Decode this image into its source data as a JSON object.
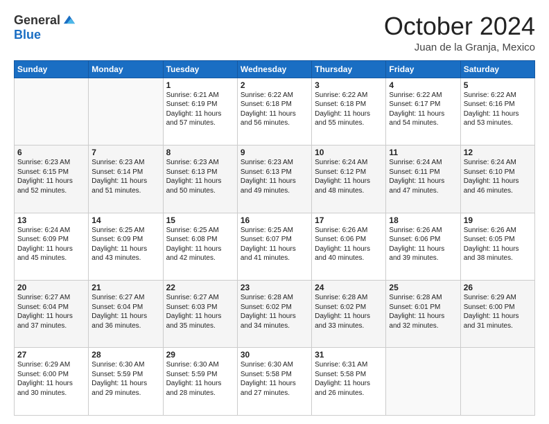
{
  "logo": {
    "general": "General",
    "blue": "Blue"
  },
  "title": "October 2024",
  "subtitle": "Juan de la Granja, Mexico",
  "weekdays": [
    "Sunday",
    "Monday",
    "Tuesday",
    "Wednesday",
    "Thursday",
    "Friday",
    "Saturday"
  ],
  "weeks": [
    [
      {
        "day": "",
        "sunrise": "",
        "sunset": "",
        "daylight": "",
        "empty": true
      },
      {
        "day": "",
        "sunrise": "",
        "sunset": "",
        "daylight": "",
        "empty": true
      },
      {
        "day": "1",
        "sunrise": "Sunrise: 6:21 AM",
        "sunset": "Sunset: 6:19 PM",
        "daylight": "Daylight: 11 hours and 57 minutes."
      },
      {
        "day": "2",
        "sunrise": "Sunrise: 6:22 AM",
        "sunset": "Sunset: 6:18 PM",
        "daylight": "Daylight: 11 hours and 56 minutes."
      },
      {
        "day": "3",
        "sunrise": "Sunrise: 6:22 AM",
        "sunset": "Sunset: 6:18 PM",
        "daylight": "Daylight: 11 hours and 55 minutes."
      },
      {
        "day": "4",
        "sunrise": "Sunrise: 6:22 AM",
        "sunset": "Sunset: 6:17 PM",
        "daylight": "Daylight: 11 hours and 54 minutes."
      },
      {
        "day": "5",
        "sunrise": "Sunrise: 6:22 AM",
        "sunset": "Sunset: 6:16 PM",
        "daylight": "Daylight: 11 hours and 53 minutes."
      }
    ],
    [
      {
        "day": "6",
        "sunrise": "Sunrise: 6:23 AM",
        "sunset": "Sunset: 6:15 PM",
        "daylight": "Daylight: 11 hours and 52 minutes."
      },
      {
        "day": "7",
        "sunrise": "Sunrise: 6:23 AM",
        "sunset": "Sunset: 6:14 PM",
        "daylight": "Daylight: 11 hours and 51 minutes."
      },
      {
        "day": "8",
        "sunrise": "Sunrise: 6:23 AM",
        "sunset": "Sunset: 6:13 PM",
        "daylight": "Daylight: 11 hours and 50 minutes."
      },
      {
        "day": "9",
        "sunrise": "Sunrise: 6:23 AM",
        "sunset": "Sunset: 6:13 PM",
        "daylight": "Daylight: 11 hours and 49 minutes."
      },
      {
        "day": "10",
        "sunrise": "Sunrise: 6:24 AM",
        "sunset": "Sunset: 6:12 PM",
        "daylight": "Daylight: 11 hours and 48 minutes."
      },
      {
        "day": "11",
        "sunrise": "Sunrise: 6:24 AM",
        "sunset": "Sunset: 6:11 PM",
        "daylight": "Daylight: 11 hours and 47 minutes."
      },
      {
        "day": "12",
        "sunrise": "Sunrise: 6:24 AM",
        "sunset": "Sunset: 6:10 PM",
        "daylight": "Daylight: 11 hours and 46 minutes."
      }
    ],
    [
      {
        "day": "13",
        "sunrise": "Sunrise: 6:24 AM",
        "sunset": "Sunset: 6:09 PM",
        "daylight": "Daylight: 11 hours and 45 minutes."
      },
      {
        "day": "14",
        "sunrise": "Sunrise: 6:25 AM",
        "sunset": "Sunset: 6:09 PM",
        "daylight": "Daylight: 11 hours and 43 minutes."
      },
      {
        "day": "15",
        "sunrise": "Sunrise: 6:25 AM",
        "sunset": "Sunset: 6:08 PM",
        "daylight": "Daylight: 11 hours and 42 minutes."
      },
      {
        "day": "16",
        "sunrise": "Sunrise: 6:25 AM",
        "sunset": "Sunset: 6:07 PM",
        "daylight": "Daylight: 11 hours and 41 minutes."
      },
      {
        "day": "17",
        "sunrise": "Sunrise: 6:26 AM",
        "sunset": "Sunset: 6:06 PM",
        "daylight": "Daylight: 11 hours and 40 minutes."
      },
      {
        "day": "18",
        "sunrise": "Sunrise: 6:26 AM",
        "sunset": "Sunset: 6:06 PM",
        "daylight": "Daylight: 11 hours and 39 minutes."
      },
      {
        "day": "19",
        "sunrise": "Sunrise: 6:26 AM",
        "sunset": "Sunset: 6:05 PM",
        "daylight": "Daylight: 11 hours and 38 minutes."
      }
    ],
    [
      {
        "day": "20",
        "sunrise": "Sunrise: 6:27 AM",
        "sunset": "Sunset: 6:04 PM",
        "daylight": "Daylight: 11 hours and 37 minutes."
      },
      {
        "day": "21",
        "sunrise": "Sunrise: 6:27 AM",
        "sunset": "Sunset: 6:04 PM",
        "daylight": "Daylight: 11 hours and 36 minutes."
      },
      {
        "day": "22",
        "sunrise": "Sunrise: 6:27 AM",
        "sunset": "Sunset: 6:03 PM",
        "daylight": "Daylight: 11 hours and 35 minutes."
      },
      {
        "day": "23",
        "sunrise": "Sunrise: 6:28 AM",
        "sunset": "Sunset: 6:02 PM",
        "daylight": "Daylight: 11 hours and 34 minutes."
      },
      {
        "day": "24",
        "sunrise": "Sunrise: 6:28 AM",
        "sunset": "Sunset: 6:02 PM",
        "daylight": "Daylight: 11 hours and 33 minutes."
      },
      {
        "day": "25",
        "sunrise": "Sunrise: 6:28 AM",
        "sunset": "Sunset: 6:01 PM",
        "daylight": "Daylight: 11 hours and 32 minutes."
      },
      {
        "day": "26",
        "sunrise": "Sunrise: 6:29 AM",
        "sunset": "Sunset: 6:00 PM",
        "daylight": "Daylight: 11 hours and 31 minutes."
      }
    ],
    [
      {
        "day": "27",
        "sunrise": "Sunrise: 6:29 AM",
        "sunset": "Sunset: 6:00 PM",
        "daylight": "Daylight: 11 hours and 30 minutes."
      },
      {
        "day": "28",
        "sunrise": "Sunrise: 6:30 AM",
        "sunset": "Sunset: 5:59 PM",
        "daylight": "Daylight: 11 hours and 29 minutes."
      },
      {
        "day": "29",
        "sunrise": "Sunrise: 6:30 AM",
        "sunset": "Sunset: 5:59 PM",
        "daylight": "Daylight: 11 hours and 28 minutes."
      },
      {
        "day": "30",
        "sunrise": "Sunrise: 6:30 AM",
        "sunset": "Sunset: 5:58 PM",
        "daylight": "Daylight: 11 hours and 27 minutes."
      },
      {
        "day": "31",
        "sunrise": "Sunrise: 6:31 AM",
        "sunset": "Sunset: 5:58 PM",
        "daylight": "Daylight: 11 hours and 26 minutes."
      },
      {
        "day": "",
        "sunrise": "",
        "sunset": "",
        "daylight": "",
        "empty": true
      },
      {
        "day": "",
        "sunrise": "",
        "sunset": "",
        "daylight": "",
        "empty": true
      }
    ]
  ]
}
